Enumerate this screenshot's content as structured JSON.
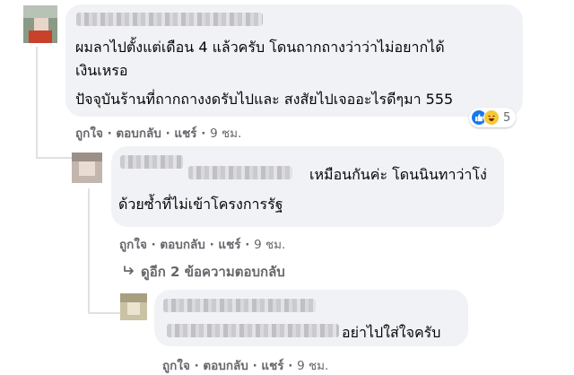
{
  "comment1": {
    "line1": "ผมลาไปตั้งแต่เดือน 4 แล้วครับ โดนถากถางว่าว่าไม่อยากได้",
    "line2": "เงินเหรอ",
    "line3": "ปัจจุบันร้านที่ถากถางงดรับไปและ สงสัยไปเจออะไรดีๆมา 555",
    "reaction_count": "5",
    "actions": {
      "like": "ถูกใจ",
      "reply": "ตอบกลับ",
      "share": "แชร์",
      "time": "9 ชม."
    }
  },
  "reply1": {
    "line1": "เหมือนกันค่ะ โดนนินทาว่าโง่",
    "line2": "ด้วยซ้ำที่ไม่เข้าโครงการรัฐ",
    "actions": {
      "like": "ถูกใจ",
      "reply": "ตอบกลับ",
      "share": "แชร์",
      "time": "9 ชม."
    }
  },
  "more_replies": {
    "label": "ดูอีก 2 ข้อความตอบกลับ"
  },
  "reply2": {
    "text": "อย่าไปใส่ใจครับ",
    "actions": {
      "like": "ถูกใจ",
      "reply": "ตอบกลับ",
      "share": "แชร์",
      "time": "9 ชม."
    }
  },
  "icons": {
    "reaction_like": "like-icon",
    "reaction_haha": "haha-icon",
    "more_arrow": "reply-arrow-icon"
  },
  "colors": {
    "bubble": "#f0f2f5",
    "meta_text": "#65676b",
    "like_blue": "#1877f2",
    "haha_yellow": "#f7c835"
  }
}
